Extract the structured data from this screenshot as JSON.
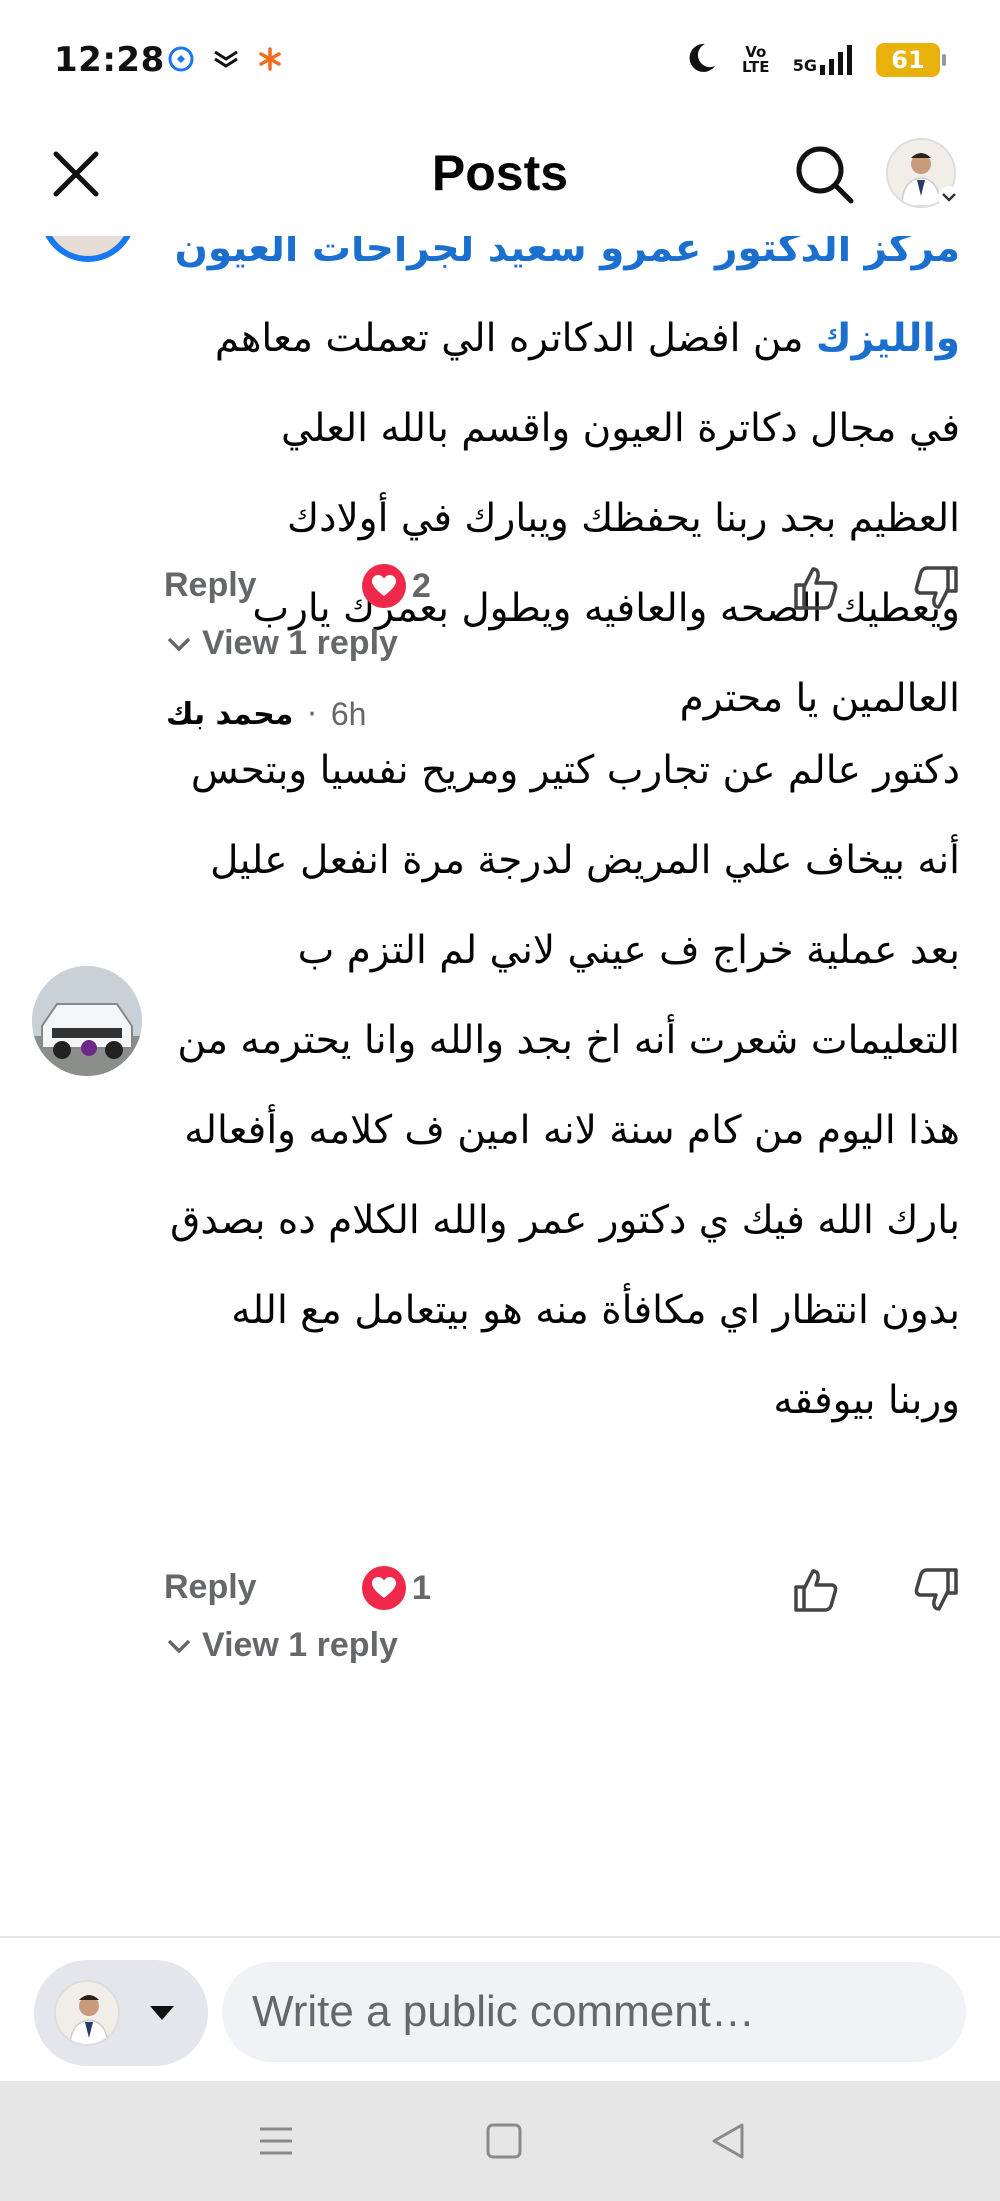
{
  "status_bar": {
    "time": "12:28",
    "network": "5G",
    "volte": "Vo LTE",
    "battery": "61"
  },
  "header": {
    "title": "Posts",
    "close_icon": "close-icon",
    "search_icon": "search-icon"
  },
  "comments": [
    {
      "mention": "مركز الدكتور عمرو سعيد لجراحات العيون والليزك",
      "text": "من افضل الدكاتره الي تعملت معاهم في مجال دكاترة العيون واقسم بالله العلي العظيم بجد ربنا يحفظك ويبارك في أولادك ويعطيك الصحه والعافيه ويطول بعمرك يارب العالمين يا محترم",
      "reply_label": "Reply",
      "reaction_count": "2",
      "view_replies": "View 1 reply"
    },
    {
      "author": "محمد بك",
      "time": "6h",
      "text": "دكتور عالم عن تجارب كتير ومريح نفسيا وبتحس أنه بيخاف علي المريض لدرجة مرة انفعل عليل بعد عملية خراج ف عيني لاني لم التزم ب التعليمات شعرت أنه اخ بجد والله وانا يحترمه من هذا اليوم من كام سنة لانه امين ف كلامه وأفعاله بارك الله فيك ي دكتور عمر والله الكلام ده بصدق بدون انتظار اي مكافأة منه هو بيتعامل مع الله وربنا بيوفقه",
      "reply_label": "Reply",
      "reaction_count": "1",
      "view_replies": "View 1 reply"
    }
  ],
  "composer": {
    "placeholder": "Write a public comment…"
  },
  "colors": {
    "mention": "#1b6fce",
    "heart": "#f0284a",
    "meta_gray": "#65676b",
    "battery": "#e9b10c"
  }
}
